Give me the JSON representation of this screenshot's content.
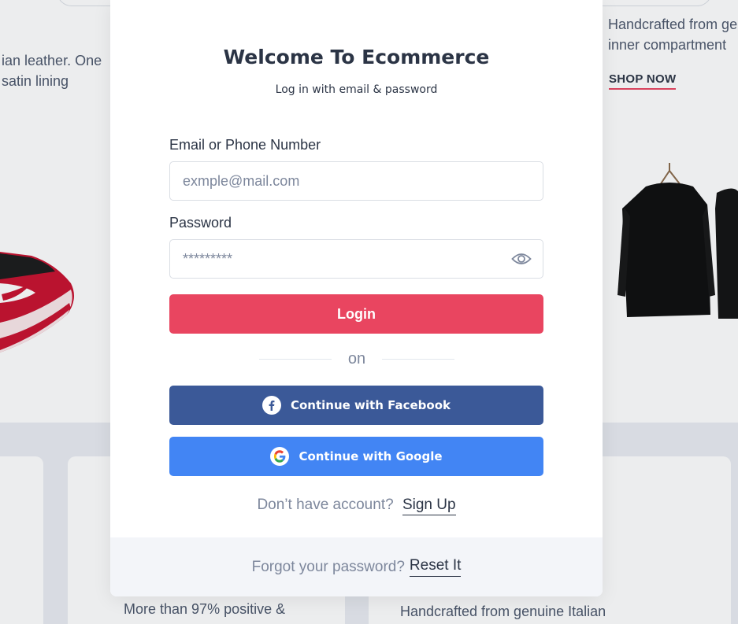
{
  "background": {
    "left_text": [
      "ian leather. One",
      " satin lining"
    ],
    "right_text": [
      "Handcrafted from ge",
      "inner compartment"
    ],
    "shop_now": "SHOP NOW",
    "card_text_1": "More than 97% positive &",
    "card_text_2": "Handcrafted from genuine Italian"
  },
  "modal": {
    "title": "Welcome To Ecommerce",
    "subtitle": "Log in with email & password",
    "email": {
      "label": "Email or Phone Number",
      "placeholder": "exmple@mail.com",
      "value": ""
    },
    "password": {
      "label": "Password",
      "placeholder": "*********",
      "value": "",
      "toggle_icon": "eye-icon"
    },
    "login_label": "Login",
    "divider_text": "on",
    "facebook_label": "Continue with Facebook",
    "google_label": "Continue with Google",
    "signup_prompt": "Don’t have account?",
    "signup_link": "Sign Up",
    "forgot_prompt": "Forgot your password?",
    "reset_link": "Reset It"
  },
  "colors": {
    "primary": "#e94560",
    "facebook": "#3b5998",
    "google": "#4285f4",
    "text_dark": "#2b3445",
    "text_muted": "#7d879c"
  }
}
